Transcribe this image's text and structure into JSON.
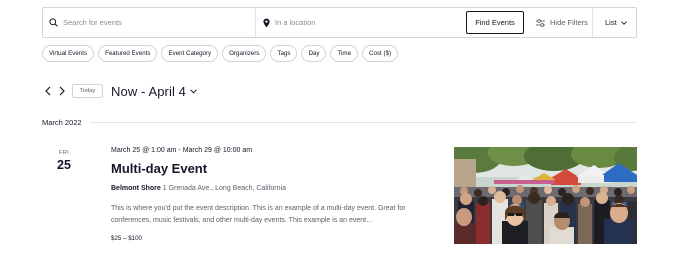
{
  "search": {
    "events_placeholder": "Search for events",
    "location_placeholder": "In a location",
    "find_label": "Find Events",
    "hide_filters_label": "Hide Filters",
    "view_label": "List"
  },
  "filters": [
    "Virtual Events",
    "Featured Events",
    "Event Category",
    "Organizers",
    "Tags",
    "Day",
    "Time",
    "Cost ($)"
  ],
  "nav": {
    "today_label": "Today",
    "range_label": "Now - April 4"
  },
  "month_label": "March 2022",
  "event": {
    "day_of_week": "FRI",
    "day_number": "25",
    "datetime": "March 25 @ 1:00 am - March 29 @ 10:00 am",
    "title": "Multi-day Event",
    "venue_name": "Belmont Shore",
    "venue_address": " 1 Grenada Ave., Long Beach, California",
    "description": "This is where you'd put the event description. This is an example of a multi-day event. Great for conferences, music festivals, and other multi-day events. This example is an event…",
    "cost": "$25 – $100"
  },
  "colors": {
    "text": "#141827",
    "muted": "#5d5f6a",
    "border": "#d5d5d5"
  },
  "icons": [
    "search-icon",
    "location-pin-icon",
    "filter-sliders-icon",
    "chevron-down-icon",
    "chevron-left-icon",
    "chevron-right-icon"
  ]
}
